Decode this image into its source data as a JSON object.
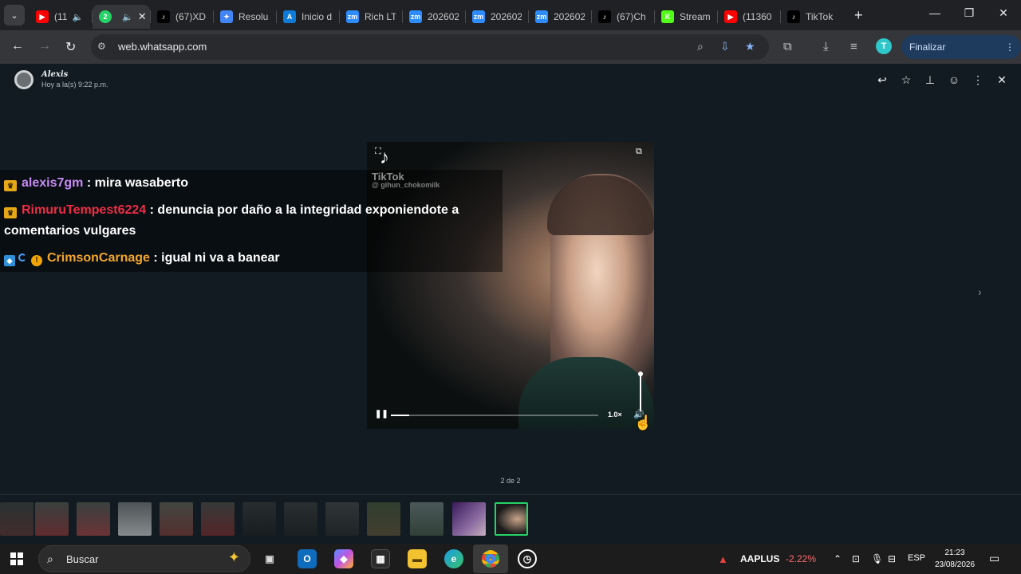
{
  "browser": {
    "tabs": [
      {
        "label": "(11",
        "icon": "youtube-icon",
        "color": "#ff0000",
        "glyph": "▶",
        "audio": true
      },
      {
        "label": "",
        "icon": "whatsapp-icon",
        "color": "#25d366",
        "glyph": "2",
        "audio": true,
        "active": true
      },
      {
        "label": "(67)XD",
        "icon": "tiktok-icon",
        "color": "#000000",
        "glyph": "♪"
      },
      {
        "label": "Resolu",
        "icon": "gemini-icon",
        "color": "#4285f4",
        "glyph": "✦"
      },
      {
        "label": "Inicio d",
        "icon": "app-a-icon",
        "color": "#0f7bd8",
        "glyph": "A"
      },
      {
        "label": "Rich LT",
        "icon": "zoom-icon",
        "color": "#2d8cff",
        "glyph": "zm"
      },
      {
        "label": "202602",
        "icon": "zoom-icon",
        "color": "#2d8cff",
        "glyph": "zm"
      },
      {
        "label": "202602",
        "icon": "zoom-icon",
        "color": "#2d8cff",
        "glyph": "zm"
      },
      {
        "label": "202602",
        "icon": "zoom-icon",
        "color": "#2d8cff",
        "glyph": "zm"
      },
      {
        "label": "(67)Ch",
        "icon": "tiktok-icon",
        "color": "#000000",
        "glyph": "♪"
      },
      {
        "label": "Stream",
        "icon": "kick-icon",
        "color": "#53fc18",
        "glyph": "K"
      },
      {
        "label": "(11360",
        "icon": "youtube-icon",
        "color": "#ff0000",
        "glyph": "▶"
      },
      {
        "label": "TikTok",
        "icon": "tiktok-icon",
        "color": "#000000",
        "glyph": "♪"
      }
    ],
    "url": "web.whatsapp.com",
    "profile_initial": "T",
    "update_label": "Finalizar actualización"
  },
  "viewer": {
    "sender_name": "Alexis",
    "sender_time": "Hoy a la(s) 9:22 p.m.",
    "video": {
      "platform": "TikTok",
      "handle": "@ gihun_chokomilk",
      "speed": "1.0×",
      "progress": 0.09,
      "volume": 1.0
    },
    "counter": "2 de 2"
  },
  "chat": [
    {
      "badges": [
        "crown"
      ],
      "user": "alexis7gm",
      "user_color": "#c88bf5",
      "message": " : mira wasaberto"
    },
    {
      "badges": [
        "crown"
      ],
      "user": "RimuruTempest6224",
      "user_color": "#ee2d45",
      "message": " : denuncia por daño a la integridad exponiendote a comentarios vulgares"
    },
    {
      "badges": [
        "cube",
        "ring",
        "warn"
      ],
      "user": "CrimsonCarnage",
      "user_color": "#f3a62a",
      "message": " : igual ni va a banear"
    }
  ],
  "taskbar": {
    "search_placeholder": "Buscar",
    "stock_name": "AAPLUS",
    "stock_change": "-2.22%",
    "language": "ESP",
    "time": "21:23",
    "date": "23/08/2026"
  }
}
